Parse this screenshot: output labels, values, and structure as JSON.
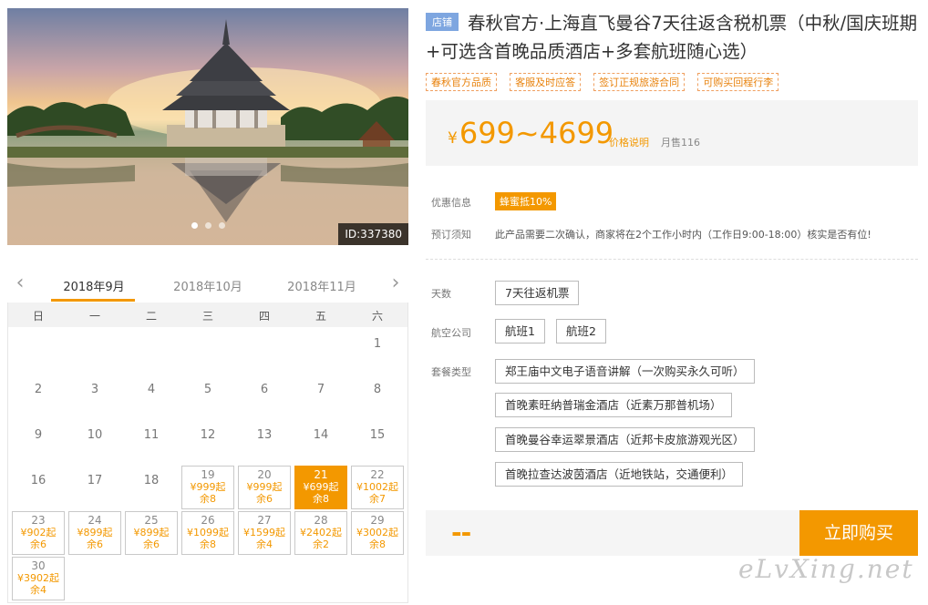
{
  "hero": {
    "id_badge": "ID:337380"
  },
  "calendar": {
    "months": [
      "2018年9月",
      "2018年10月",
      "2018年11月"
    ],
    "weekdays": [
      "日",
      "一",
      "二",
      "三",
      "四",
      "五",
      "六"
    ],
    "plain_days": [
      "1",
      "2",
      "3",
      "4",
      "5",
      "6",
      "7",
      "8",
      "9",
      "10",
      "11",
      "12",
      "13",
      "14",
      "15",
      "16",
      "17",
      "18"
    ],
    "avail_days": [
      {
        "day": "19",
        "price": "¥999起",
        "stock": "余8"
      },
      {
        "day": "20",
        "price": "¥999起",
        "stock": "余6"
      },
      {
        "day": "21",
        "price": "¥699起",
        "stock": "余8"
      },
      {
        "day": "22",
        "price": "¥1002起",
        "stock": "余7"
      },
      {
        "day": "23",
        "price": "¥902起",
        "stock": "余6"
      },
      {
        "day": "24",
        "price": "¥899起",
        "stock": "余6"
      },
      {
        "day": "25",
        "price": "¥899起",
        "stock": "余6"
      },
      {
        "day": "26",
        "price": "¥1099起",
        "stock": "余8"
      },
      {
        "day": "27",
        "price": "¥1599起",
        "stock": "余4"
      },
      {
        "day": "28",
        "price": "¥2402起",
        "stock": "余2"
      },
      {
        "day": "29",
        "price": "¥3002起",
        "stock": "余8"
      },
      {
        "day": "30",
        "price": "¥3902起",
        "stock": "余4"
      }
    ]
  },
  "product": {
    "shop_badge": "店铺",
    "title": "春秋官方·上海直飞曼谷7天往返含税机票（中秋/国庆班期+可选含首晚品质酒店+多套航班随心选）",
    "tags": [
      "春秋官方品质",
      "客服及时应答",
      "签订正规旅游合同",
      "可购买回程行李"
    ],
    "price_yen": "¥",
    "price_range": "699~4699",
    "price_note": "价格说明",
    "monthly_sales": "月售116"
  },
  "info": {
    "promo_label": "优惠信息",
    "promo_tag": "蜂蜜抵10%",
    "notice_label": "预订须知",
    "notice_text": "此产品需要二次确认，商家将在2个工作小时内（工作日9:00-18:00）核实是否有位!"
  },
  "options": {
    "days_label": "天数",
    "days_value": "7天往返机票",
    "airline_label": "航空公司",
    "airlines": [
      "航班1",
      "航班2"
    ],
    "package_label": "套餐类型",
    "packages": [
      "郑王庙中文电子语音讲解（一次购买永久可听）",
      "首晚素旺纳普瑞金酒店（近素万那普机场）",
      "首晚曼谷幸运翠景酒店（近邦卡皮旅游观光区）",
      "首晚拉查达波茵酒店（近地铁站，交通便利）"
    ]
  },
  "buy": {
    "total": "--",
    "button": "立即购买"
  },
  "watermark": "eLvXing.net",
  "colors": {
    "accent": "#f39800",
    "shop_badge": "#7ea6e0"
  }
}
